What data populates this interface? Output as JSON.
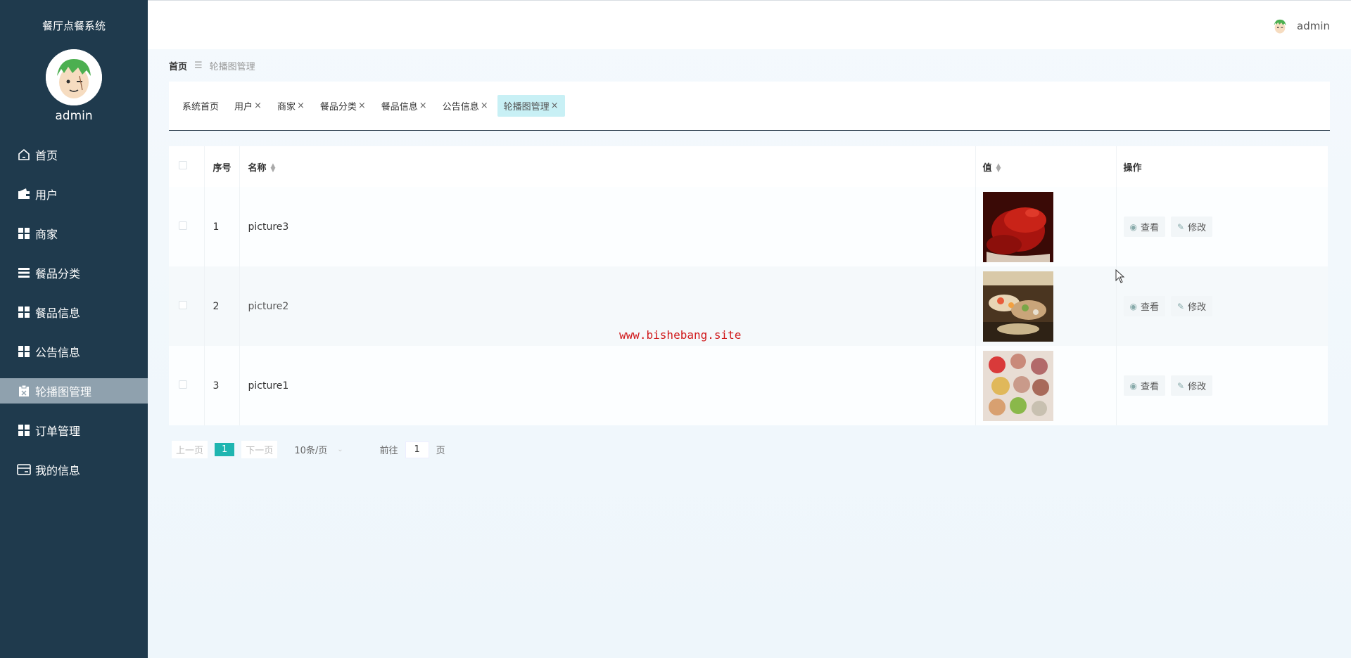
{
  "app": {
    "title": "餐厅点餐系统",
    "username": "admin"
  },
  "sidebar": {
    "items": [
      {
        "label": "首页",
        "icon": "home-icon"
      },
      {
        "label": "用户",
        "icon": "wallet-icon"
      },
      {
        "label": "商家",
        "icon": "grid-icon"
      },
      {
        "label": "餐品分类",
        "icon": "list-icon"
      },
      {
        "label": "餐品信息",
        "icon": "grid-icon"
      },
      {
        "label": "公告信息",
        "icon": "grid-icon"
      },
      {
        "label": "轮播图管理",
        "icon": "clipboard-icon",
        "active": true
      },
      {
        "label": "订单管理",
        "icon": "grid-icon"
      },
      {
        "label": "我的信息",
        "icon": "card-icon"
      }
    ]
  },
  "header": {
    "username": "admin"
  },
  "breadcrumb": {
    "home": "首页",
    "separator": "☰",
    "current": "轮播图管理"
  },
  "tabs": [
    {
      "label": "系统首页",
      "closable": false
    },
    {
      "label": "用户",
      "closable": true
    },
    {
      "label": "商家",
      "closable": true
    },
    {
      "label": "餐品分类",
      "closable": true
    },
    {
      "label": "餐品信息",
      "closable": true
    },
    {
      "label": "公告信息",
      "closable": true
    },
    {
      "label": "轮播图管理",
      "closable": true,
      "active": true
    }
  ],
  "table": {
    "headers": {
      "index": "序号",
      "name": "名称",
      "value": "值",
      "actions": "操作"
    },
    "rows": [
      {
        "index": "1",
        "name": "picture3",
        "image": "lobster-photo"
      },
      {
        "index": "2",
        "name": "picture2",
        "image": "sushi-platter-photo"
      },
      {
        "index": "3",
        "name": "picture1",
        "image": "macarons-photo"
      }
    ],
    "view_label": "查看",
    "edit_label": "修改"
  },
  "pagination": {
    "prev": "上一页",
    "current": "1",
    "next": "下一页",
    "page_size": "10条/页",
    "goto_label": "前往",
    "goto_value": "1",
    "page_suffix": "页"
  },
  "watermark": "www.bishebang.site",
  "colors": {
    "sidebar": "#1f3a4d",
    "active_menu": "#8fa1ae",
    "accent": "#1fb5b0",
    "tab_active": "#c8f0f5"
  }
}
